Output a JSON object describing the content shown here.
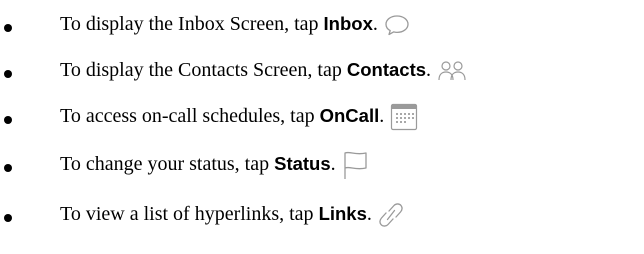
{
  "items": [
    {
      "text": "To display the Inbox Screen, tap",
      "keyword": "Inbox",
      "punct": ".",
      "icon": "chat-bubble-icon"
    },
    {
      "text": "To display the Contacts Screen, tap",
      "keyword": "Contacts",
      "punct": ".",
      "icon": "people-icon"
    },
    {
      "text": "To access on-call schedules, tap",
      "keyword": "OnCall",
      "punct": ".",
      "icon": "calendar-icon"
    },
    {
      "text": "To change your status, tap",
      "keyword": "Status",
      "punct": ".",
      "icon": "flag-icon"
    },
    {
      "text": "To view a list of hyperlinks, tap",
      "keyword": "Links",
      "punct": ".",
      "icon": "link-icon"
    }
  ],
  "colors": {
    "text": "#000000",
    "icon": "#9a9a9a"
  }
}
